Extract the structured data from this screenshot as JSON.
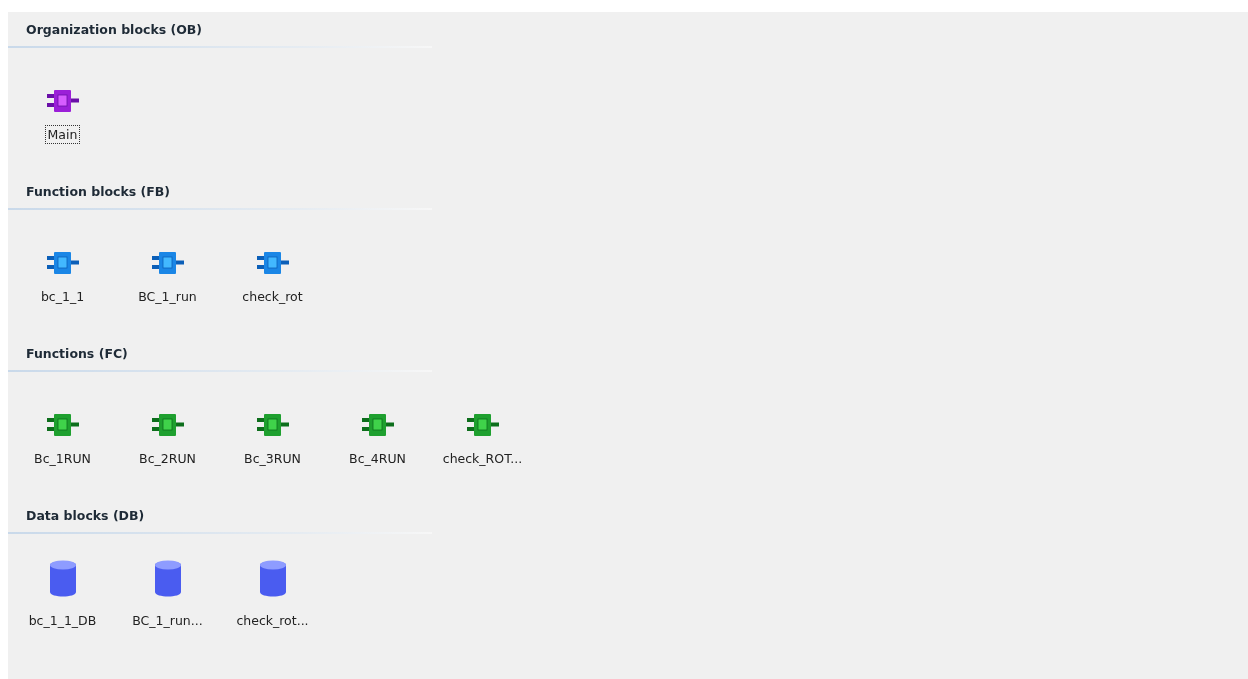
{
  "sections": [
    {
      "title": "Organization blocks (OB)",
      "kind": "ob",
      "items": [
        {
          "label": "Main",
          "selected": true
        }
      ]
    },
    {
      "title": "Function blocks (FB)",
      "kind": "fb",
      "items": [
        {
          "label": "bc_1_1",
          "selected": false
        },
        {
          "label": "BC_1_run",
          "selected": false
        },
        {
          "label": "check_rot",
          "selected": false
        }
      ]
    },
    {
      "title": "Functions (FC)",
      "kind": "fc",
      "items": [
        {
          "label": "Bc_1RUN",
          "selected": false
        },
        {
          "label": "Bc_2RUN",
          "selected": false
        },
        {
          "label": "Bc_3RUN",
          "selected": false
        },
        {
          "label": "Bc_4RUN",
          "selected": false
        },
        {
          "label": "check_ROT...",
          "selected": false
        }
      ]
    },
    {
      "title": "Data blocks (DB)",
      "kind": "db",
      "items": [
        {
          "label": "bc_1_1_DB",
          "selected": false
        },
        {
          "label": "BC_1_run...",
          "selected": false
        },
        {
          "label": "check_rot...",
          "selected": false
        }
      ]
    }
  ]
}
